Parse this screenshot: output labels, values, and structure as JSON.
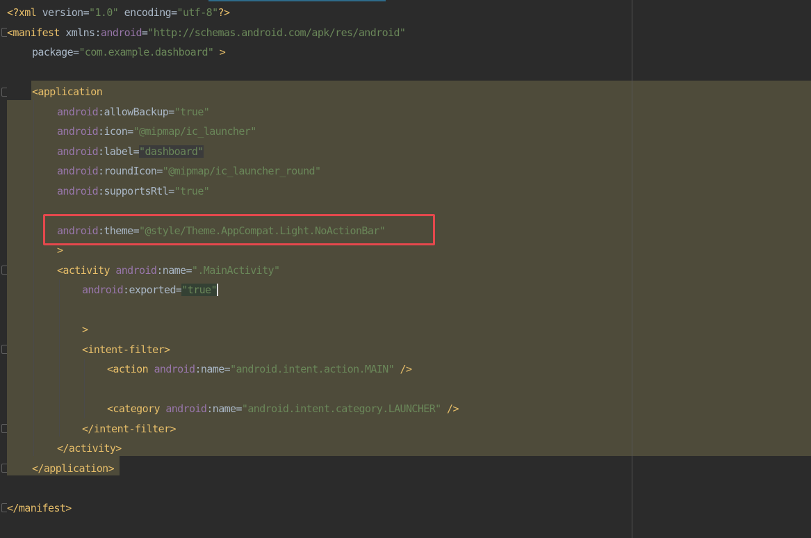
{
  "editor": {
    "file_type": "XML (AndroidManifest)",
    "lines": [
      {
        "id": "l1",
        "indent": 0,
        "tokens": [
          [
            "t-tag",
            "<?xml "
          ],
          [
            "t-plain",
            "version="
          ],
          [
            "t-str",
            "\"1.0\""
          ],
          [
            "t-plain",
            " encoding="
          ],
          [
            "t-str",
            "\"utf-8\""
          ],
          [
            "t-tag",
            "?>"
          ]
        ]
      },
      {
        "id": "l2",
        "indent": 0,
        "tokens": [
          [
            "t-tag",
            "<manifest "
          ],
          [
            "t-plain",
            "xmlns:"
          ],
          [
            "t-ns",
            "android"
          ],
          [
            "t-plain",
            "="
          ],
          [
            "t-str",
            "\"http://schemas.android.com/apk/res/android\""
          ]
        ]
      },
      {
        "id": "l3",
        "indent": 1,
        "tokens": [
          [
            "t-plain",
            "package="
          ],
          [
            "t-str",
            "\"com.example.dashboard\""
          ],
          [
            "t-tag",
            " >"
          ]
        ]
      },
      {
        "id": "l4",
        "indent": 0,
        "tokens": []
      },
      {
        "id": "l5",
        "indent": 1,
        "tokens": [
          [
            "t-tag",
            "<application"
          ]
        ]
      },
      {
        "id": "l6",
        "indent": 2,
        "tokens": [
          [
            "t-ns",
            "android"
          ],
          [
            "t-plain",
            ":allowBackup="
          ],
          [
            "t-str",
            "\"true\""
          ]
        ]
      },
      {
        "id": "l7",
        "indent": 2,
        "tokens": [
          [
            "t-ns",
            "android"
          ],
          [
            "t-plain",
            ":icon="
          ],
          [
            "t-str",
            "\"@mipmap/ic_launcher\""
          ]
        ]
      },
      {
        "id": "l8",
        "indent": 2,
        "tokens": [
          [
            "t-ns",
            "android"
          ],
          [
            "t-plain",
            ":label="
          ],
          [
            "t-str t-hl",
            "\"dashboard\""
          ]
        ]
      },
      {
        "id": "l9",
        "indent": 2,
        "tokens": [
          [
            "t-ns",
            "android"
          ],
          [
            "t-plain",
            ":roundIcon="
          ],
          [
            "t-str",
            "\"@mipmap/ic_launcher_round\""
          ]
        ]
      },
      {
        "id": "l10",
        "indent": 2,
        "tokens": [
          [
            "t-ns",
            "android"
          ],
          [
            "t-plain",
            ":supportsRtl="
          ],
          [
            "t-str",
            "\"true\""
          ]
        ]
      },
      {
        "id": "l11",
        "indent": 0,
        "tokens": []
      },
      {
        "id": "l12",
        "indent": 2,
        "tokens": [
          [
            "t-ns",
            "android"
          ],
          [
            "t-plain",
            ":theme="
          ],
          [
            "t-str",
            "\"@style/Theme.AppCompat.Light.NoActionBar\""
          ]
        ]
      },
      {
        "id": "l13",
        "indent": 2,
        "tokens": [
          [
            "t-tag",
            ">"
          ]
        ]
      },
      {
        "id": "l14",
        "indent": 2,
        "tokens": [
          [
            "t-tag",
            "<activity "
          ],
          [
            "t-ns",
            "android"
          ],
          [
            "t-plain",
            ":name="
          ],
          [
            "t-str",
            "\".MainActivity\""
          ]
        ]
      },
      {
        "id": "l15",
        "indent": 3,
        "tokens": [
          [
            "t-ns",
            "android"
          ],
          [
            "t-plain",
            ":exported="
          ],
          [
            "t-str t-hl2",
            "\"true\""
          ],
          [
            "t-cursor",
            ""
          ]
        ]
      },
      {
        "id": "l16",
        "indent": 0,
        "tokens": []
      },
      {
        "id": "l17",
        "indent": 3,
        "tokens": [
          [
            "t-tag",
            ">"
          ]
        ]
      },
      {
        "id": "l18",
        "indent": 3,
        "tokens": [
          [
            "t-tag",
            "<intent-filter>"
          ]
        ]
      },
      {
        "id": "l19",
        "indent": 4,
        "tokens": [
          [
            "t-tag",
            "<action "
          ],
          [
            "t-ns",
            "android"
          ],
          [
            "t-plain",
            ":name="
          ],
          [
            "t-str",
            "\"android.intent.action.MAIN\""
          ],
          [
            "t-tag",
            " />"
          ]
        ]
      },
      {
        "id": "l20",
        "indent": 0,
        "tokens": []
      },
      {
        "id": "l21",
        "indent": 4,
        "tokens": [
          [
            "t-tag",
            "<category "
          ],
          [
            "t-ns",
            "android"
          ],
          [
            "t-plain",
            ":name="
          ],
          [
            "t-str",
            "\"android.intent.category.LAUNCHER\""
          ],
          [
            "t-tag",
            " />"
          ]
        ]
      },
      {
        "id": "l22",
        "indent": 3,
        "tokens": [
          [
            "t-tag",
            "</intent-filter>"
          ]
        ]
      },
      {
        "id": "l23",
        "indent": 2,
        "tokens": [
          [
            "t-tag",
            "</activity>"
          ]
        ]
      },
      {
        "id": "l24",
        "indent": 1,
        "tokens": [
          [
            "t-tag",
            "</application>"
          ]
        ]
      },
      {
        "id": "l25",
        "indent": 0,
        "tokens": []
      },
      {
        "id": "l26",
        "indent": 0,
        "tokens": [
          [
            "t-tag",
            "</manifest>"
          ]
        ]
      }
    ]
  },
  "annotation": {
    "type": "highlight-box",
    "target_line": "l12",
    "color": "#e5484d"
  },
  "colors": {
    "background": "#2b2b2b",
    "selection": "#4e4b3a",
    "tag": "#e8bf6a",
    "text": "#a9b7c6",
    "namespace": "#9876aa",
    "string": "#6a8759"
  }
}
